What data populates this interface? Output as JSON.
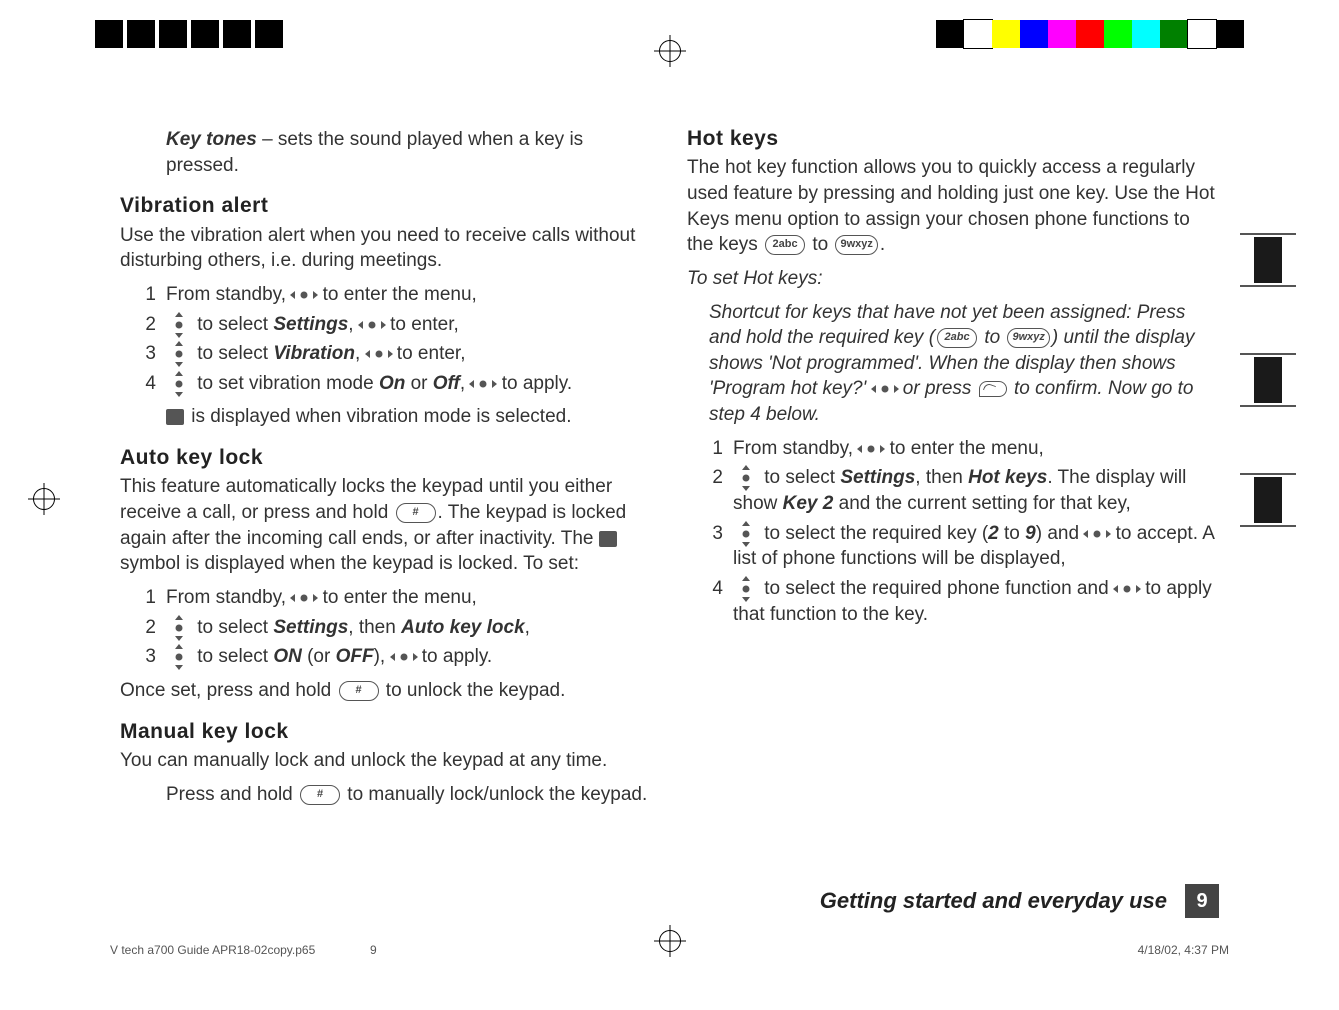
{
  "colorbar": [
    "#000000",
    "#ffffff",
    "#ffff00",
    "#0000ff",
    "#ff00ff",
    "#ff0000",
    "#00ff00",
    "#00ffff",
    "#008000",
    "#ffffff",
    "#000000"
  ],
  "left": {
    "keyTones": {
      "label": "Key tones",
      "desc": " – sets the sound played when a key is pressed."
    },
    "vibration": {
      "title": "Vibration alert",
      "p": "Use the vibration alert when you need to receive calls without disturbing others, i.e. during meetings.",
      "s1a": "From standby, ",
      "s1b": " to enter the menu,",
      "s2a": " to select ",
      "s2_settings": "Settings",
      "s2b": ", ",
      "s2c": " to enter,",
      "s3a": " to select ",
      "s3_vibration": "Vibration",
      "s3b": ", ",
      "s3c": " to enter,",
      "s4a": " to set vibration mode ",
      "s4_on": "On",
      "s4b": " or ",
      "s4_off": "Off",
      "s4c": ", ",
      "s4d": " to apply.",
      "note": " is displayed when vibration mode is selected."
    },
    "auto": {
      "title": "Auto key lock",
      "p1a": "This feature automatically locks the keypad until you either receive a call, or press and hold ",
      "p1b": ". The keypad is locked again after the incoming call ends, or after inactivity. The ",
      "p1c": " symbol is displayed when the keypad is locked. To set:",
      "s1a": "From standby, ",
      "s1b": " to enter the menu,",
      "s2a": " to select ",
      "s2_settings": "Settings",
      "s2b": ", then ",
      "s2_auto": "Auto key lock",
      "s2c": ",",
      "s3a": " to select ",
      "s3_on": "ON",
      "s3b": " (or ",
      "s3_off": "OFF",
      "s3c": "), ",
      "s3d": " to apply.",
      "post_a": "Once set, press and hold ",
      "post_b": " to unlock the keypad."
    },
    "manual": {
      "title": "Manual key lock",
      "p": "You can manually lock and unlock the keypad at any time.",
      "s_a": "Press and hold ",
      "s_b": " to manually lock/unlock the keypad."
    }
  },
  "right": {
    "hot": {
      "title": "Hot keys",
      "p_a": "The hot key function allows you to quickly access a regularly used feature by pressing and holding just one key. Use the Hot Keys menu option to assign your chosen phone functions to the keys ",
      "p_b": " to ",
      "p_c": ".",
      "subtitle": "To set Hot keys:",
      "note_a": "Shortcut for keys that have not yet been assigned: Press and hold the required key (",
      "note_b": " to ",
      "note_c": ") until the display shows 'Not programmed'. When the display then shows 'Program hot key?' ",
      "note_d": " or press ",
      "note_e": " to confirm. Now go to step 4 below.",
      "s1a": "From standby, ",
      "s1b": " to enter the menu,",
      "s2a": " to select ",
      "s2_settings": "Settings",
      "s2b": ", then ",
      "s2_hot": "Hot keys",
      "s2c": ". The display will show ",
      "s2_key2": "Key 2",
      "s2d": " and the current setting for that key,",
      "s3a": " to select the required key (",
      "s3_2": "2",
      "s3_to": " to ",
      "s3_9": "9",
      "s3b": ") and ",
      "s3c": " to accept. A list of phone functions will be displayed,",
      "s4a": " to select the required phone function and ",
      "s4b": " to apply that function to the key."
    }
  },
  "keys": {
    "hash": "#",
    "k2": "2abc",
    "k9": "9wxyz"
  },
  "footer": {
    "label": "Getting started and everyday use",
    "page": "9"
  },
  "printfoot": {
    "file": "V tech a700 Guide APR18-02copy.p65",
    "page": "9",
    "stamp": "4/18/02, 4:37 PM"
  }
}
